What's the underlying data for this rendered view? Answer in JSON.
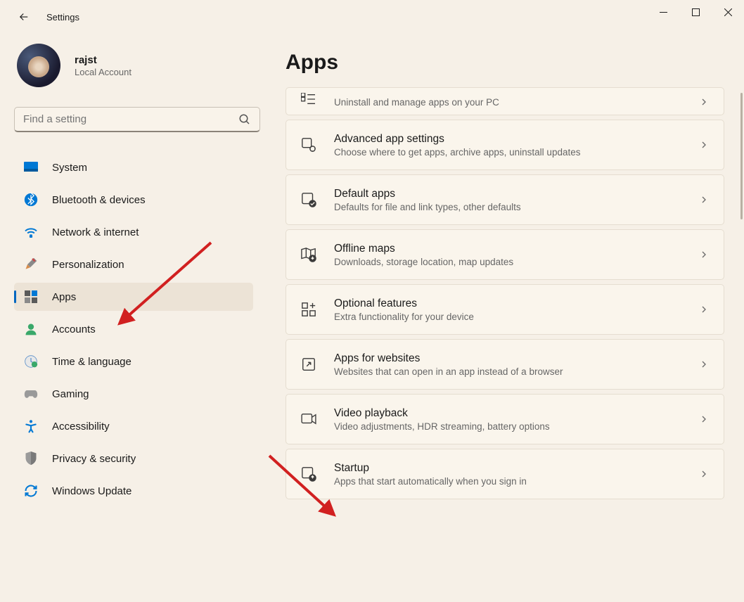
{
  "titlebar": {
    "title": "Settings"
  },
  "profile": {
    "name": "rajst",
    "type": "Local Account"
  },
  "search": {
    "placeholder": "Find a setting"
  },
  "nav": {
    "items": [
      {
        "label": "System"
      },
      {
        "label": "Bluetooth & devices"
      },
      {
        "label": "Network & internet"
      },
      {
        "label": "Personalization"
      },
      {
        "label": "Apps"
      },
      {
        "label": "Accounts"
      },
      {
        "label": "Time & language"
      },
      {
        "label": "Gaming"
      },
      {
        "label": "Accessibility"
      },
      {
        "label": "Privacy & security"
      },
      {
        "label": "Windows Update"
      }
    ]
  },
  "main": {
    "title": "Apps",
    "cards": [
      {
        "title": "",
        "desc": "Uninstall and manage apps on your PC"
      },
      {
        "title": "Advanced app settings",
        "desc": "Choose where to get apps, archive apps, uninstall updates"
      },
      {
        "title": "Default apps",
        "desc": "Defaults for file and link types, other defaults"
      },
      {
        "title": "Offline maps",
        "desc": "Downloads, storage location, map updates"
      },
      {
        "title": "Optional features",
        "desc": "Extra functionality for your device"
      },
      {
        "title": "Apps for websites",
        "desc": "Websites that can open in an app instead of a browser"
      },
      {
        "title": "Video playback",
        "desc": "Video adjustments, HDR streaming, battery options"
      },
      {
        "title": "Startup",
        "desc": "Apps that start automatically when you sign in"
      }
    ]
  }
}
